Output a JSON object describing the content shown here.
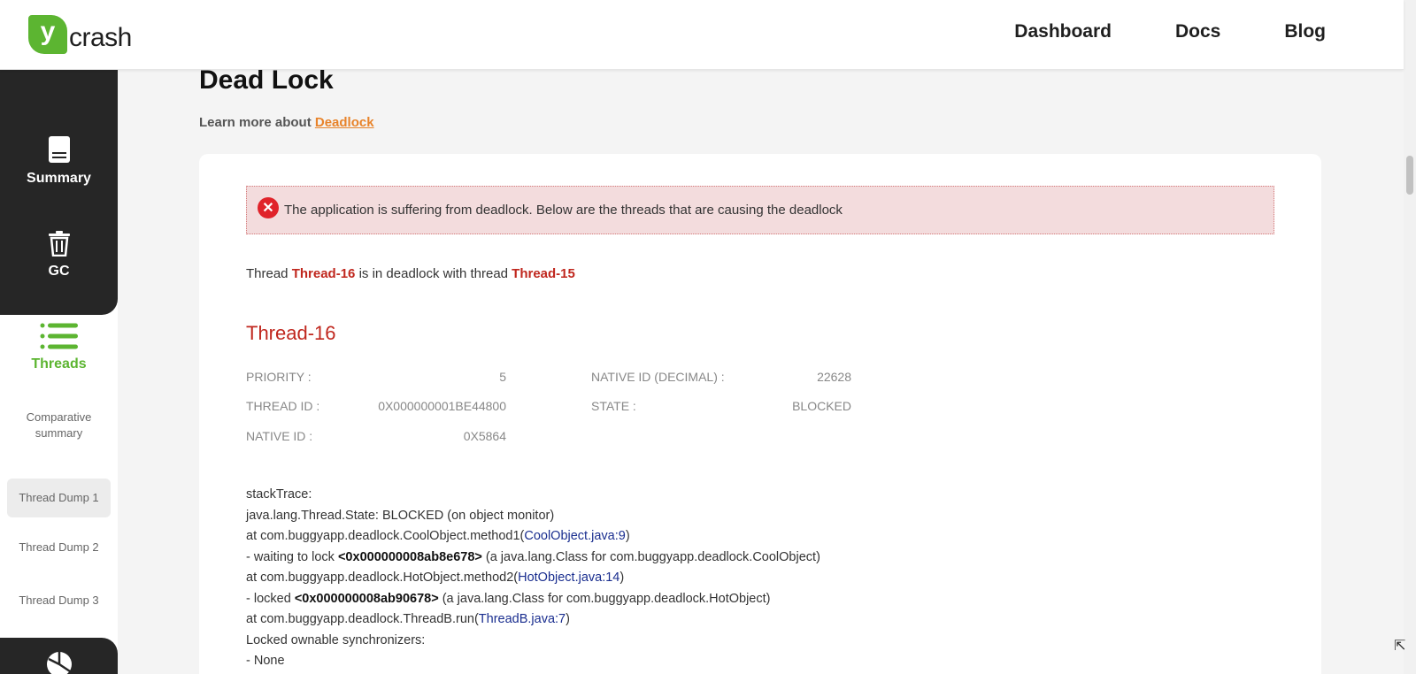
{
  "header": {
    "logo_badge": "y",
    "logo_text": "crash",
    "nav": [
      "Dashboard",
      "Docs",
      "Blog"
    ]
  },
  "sidebar": {
    "summary_label": "Summary",
    "gc_label": "GC",
    "threads_label": "Threads",
    "comparative_line1": "Comparative",
    "comparative_line2": "summary",
    "thread_dumps": [
      "Thread Dump 1",
      "Thread Dump 2",
      "Thread Dump 3"
    ]
  },
  "main": {
    "title": "Dead Lock",
    "learn_prefix": "Learn more about ",
    "learn_link": "Deadlock",
    "alert_text": "The application is suffering from deadlock. Below are the threads that are causing the deadlock",
    "deadlock_sentence": {
      "part1": "Thread ",
      "thread_a": "Thread-16",
      "part2": " is in deadlock with thread ",
      "thread_b": "Thread-15"
    },
    "thread_title": "Thread-16",
    "props": {
      "priority_label": "PRIORITY :",
      "priority_value": "5",
      "native_id_dec_label": "NATIVE ID (DECIMAL) :",
      "native_id_dec_value": "22628",
      "thread_id_label": "THREAD ID :",
      "thread_id_value": "0X000000001BE44800",
      "state_label": "STATE :",
      "state_value": "BLOCKED",
      "native_id_label": "NATIVE ID :",
      "native_id_value": "0X5864"
    },
    "stack": {
      "l1": "stackTrace:",
      "l2": "java.lang.Thread.State: BLOCKED (on object monitor)",
      "l3_pre": "at com.buggyapp.deadlock.CoolObject.method1(",
      "l3_link": "CoolObject.java:9",
      "l3_post": ")",
      "l4_pre": "- waiting to lock ",
      "l4_bold": "<0x000000008ab8e678>",
      "l4_post": " (a java.lang.Class for com.buggyapp.deadlock.CoolObject)",
      "l5_pre": "at com.buggyapp.deadlock.HotObject.method2(",
      "l5_link": "HotObject.java:14",
      "l5_post": ")",
      "l6_pre": "- locked ",
      "l6_bold": "<0x000000008ab90678>",
      "l6_post": " (a java.lang.Class for com.buggyapp.deadlock.HotObject)",
      "l7_pre": "at com.buggyapp.deadlock.ThreadB.run(",
      "l7_link": "ThreadB.java:7",
      "l7_post": ")",
      "l8": "Locked ownable synchronizers:",
      "l9": "- None"
    }
  },
  "colors": {
    "brand_green": "#5cb531",
    "danger_red": "#c0271e",
    "link_orange": "#e8832a"
  }
}
